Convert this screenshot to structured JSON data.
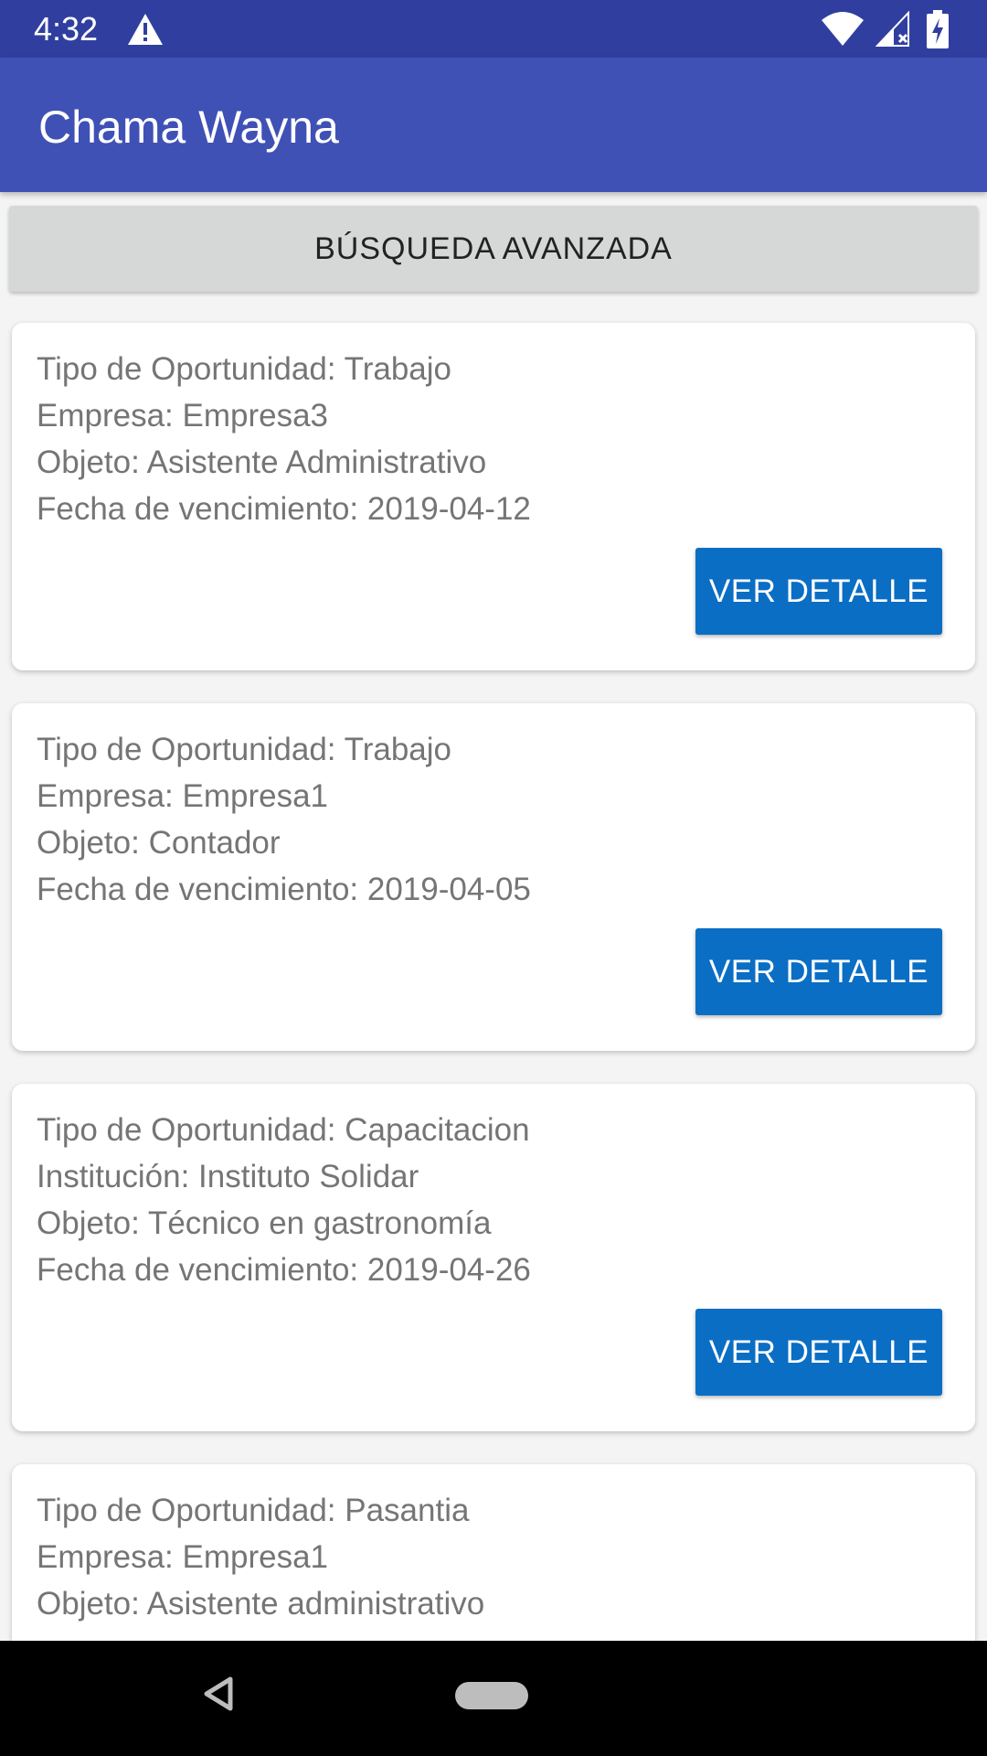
{
  "status_bar": {
    "time": "4:32",
    "icons": [
      "warning-icon",
      "wifi-icon",
      "cell-signal-icon",
      "battery-charging-icon"
    ]
  },
  "app_bar": {
    "title": "Chama Wayna",
    "color": "#3f51b5"
  },
  "search": {
    "label": "BÚSQUEDA AVANZADA"
  },
  "cards": [
    {
      "line1": "Tipo de Oportunidad: Trabajo",
      "line2": "Empresa: Empresa3",
      "line3": "Objeto: Asistente Administrativo",
      "line4": "Fecha de vencimiento: 2019-04-12",
      "button": "VER DETALLE"
    },
    {
      "line1": "Tipo de Oportunidad: Trabajo",
      "line2": "Empresa: Empresa1",
      "line3": "Objeto: Contador",
      "line4": "Fecha de vencimiento: 2019-04-05",
      "button": "VER DETALLE"
    },
    {
      "line1": "Tipo de Oportunidad: Capacitacion",
      "line2": "Institución: Instituto Solidar",
      "line3": "Objeto: Técnico en gastronomía",
      "line4": "Fecha de vencimiento: 2019-04-26",
      "button": "VER DETALLE"
    },
    {
      "line1": "Tipo de Oportunidad: Pasantia",
      "line2": "Empresa: Empresa1",
      "line3": "Objeto: Asistente administrativo"
    }
  ],
  "nav_bar": {
    "icons": [
      "back-icon",
      "home-pill-icon"
    ]
  },
  "colors": {
    "status_bar": "#303f9f",
    "button": "#0a6ec4",
    "search_button": "#d6d7d7"
  }
}
